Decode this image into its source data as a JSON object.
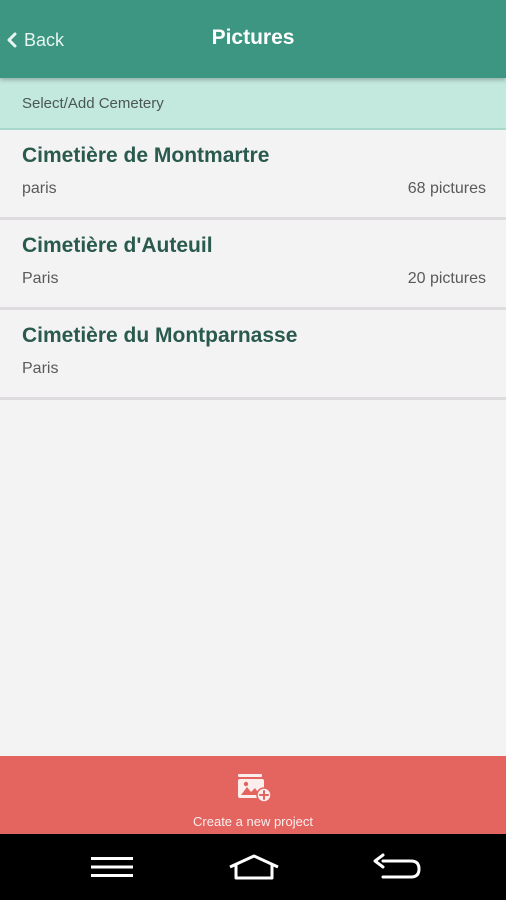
{
  "header": {
    "back_label": "Back",
    "title": "Pictures"
  },
  "subheader": {
    "label": "Select/Add Cemetery"
  },
  "cemeteries": [
    {
      "name": "Cimetière de Montmartre",
      "city": "paris",
      "count": "68 pictures"
    },
    {
      "name": "Cimetière d'Auteuil",
      "city": "Paris",
      "count": "20 pictures"
    },
    {
      "name": "Cimetière du Montparnasse",
      "city": "Paris",
      "count": ""
    }
  ],
  "footer": {
    "create_label": "Create a new project",
    "create_icon": "add-picture-icon"
  },
  "navbar": {
    "icons": [
      "menu-icon",
      "home-icon",
      "back-arrow-icon"
    ]
  },
  "colors": {
    "primary": "#3c9682",
    "subheader": "#c3e8de",
    "accent": "#e4645f",
    "item_title": "#2a5a4d"
  }
}
